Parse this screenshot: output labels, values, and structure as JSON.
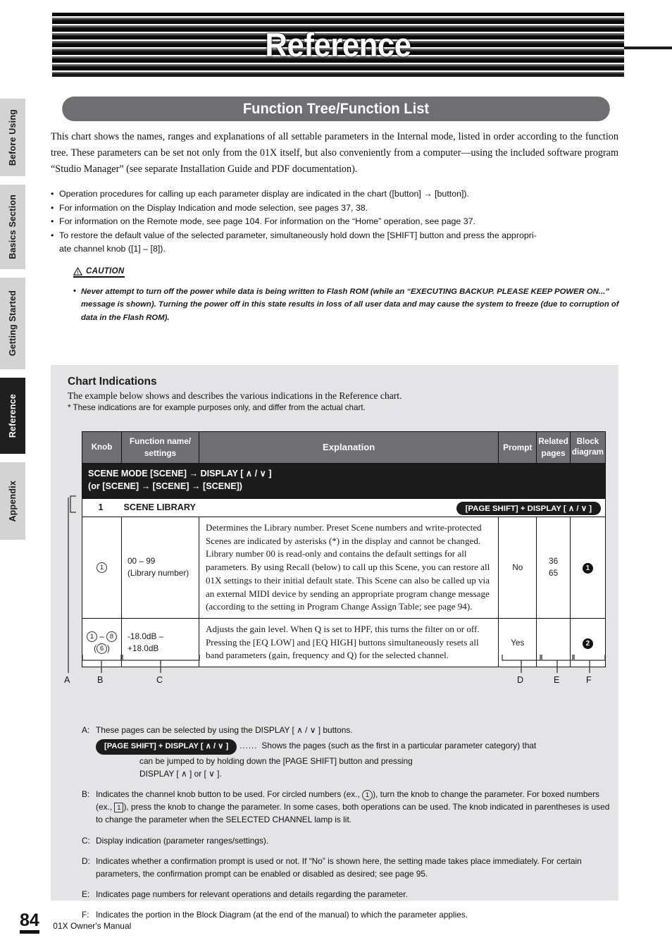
{
  "banner": {
    "title": "Reference"
  },
  "section": {
    "title": "Function Tree/Function List"
  },
  "sidebar": {
    "items": [
      {
        "label": "Before Using",
        "active": false
      },
      {
        "label": "Basics Section",
        "active": false
      },
      {
        "label": "Getting Started",
        "active": false
      },
      {
        "label": "Reference",
        "active": true
      },
      {
        "label": "Appendix",
        "active": false
      }
    ]
  },
  "intro": {
    "paragraph": "This chart shows the names, ranges and explanations of all settable parameters in the Internal mode, listed in order according to the function tree.  These parameters can be set not only from the 01X itself, but also conveniently from a computer—using the included software program “Studio Manager” (see separate Installation Guide and PDF documentation)."
  },
  "bullets": [
    "Operation procedures for calling up each parameter display are indicated in the chart ([button] → [button]).",
    "For information on the Display Indication and mode selection, see pages 37, 38.",
    "For information on the Remote mode, see page 104. For information on the “Home” operation, see page 37.",
    "To restore the default value of the selected parameter, simultaneously hold down the [SHIFT] button and press the appropri-"
  ],
  "bullet_last_cont": "ate channel knob ([1] – [8]).",
  "caution": {
    "label": "CAUTION",
    "body": "Never attempt to turn off the power while data is being written to Flash ROM (while an “EXECUTING BACKUP.  PLEASE KEEP POWER ON...” message is shown).  Turning the power off in this state results in loss of all user data and may cause the system to freeze (due to corruption of data in the Flash ROM)."
  },
  "chart_indications": {
    "title": "Chart Indications",
    "subtitle": "The example below shows and describes the various indications in the Reference chart.",
    "note": "* These indications are for example purposes only, and differ from the actual chart."
  },
  "table": {
    "headers": {
      "knob": "Knob",
      "function": "Function name/\nsettings",
      "explanation": "Explanation",
      "prompt": "Prompt",
      "related": "Related\npages",
      "block": "Block\ndiagram"
    },
    "header_function_line1": "Function name/",
    "header_function_line2": "settings",
    "header_related_line1": "Related",
    "header_related_line2": "pages",
    "header_block_line1": "Block",
    "header_block_line2": "diagram",
    "mode_row_line1": "SCENE MODE     [SCENE] → DISPLAY [ ∧ / ∨ ]",
    "mode_row_line2": "(or [SCENE] → [SCENE] → [SCENE])",
    "section_number": "1",
    "section_name": "SCENE LIBRARY",
    "section_badge": "[PAGE SHIFT] + DISPLAY [ ∧ / ∨ ]",
    "rows": [
      {
        "knob": "①",
        "function_line1": "00 – 99",
        "function_line2": "(Library number)",
        "explanation": "Determines the Library number.  Preset Scene numbers and write-protected Scenes are indicated by asterisks (*) in the display and cannot be changed. Library number 00 is read-only and contains the default settings for all parameters.  By using Recall (below) to call up this Scene, you can restore all 01X settings to their initial default state.  This Scene can also be called up via an external MIDI device by sending an appropriate program change message (according to the setting in Program Change Assign Table; see page 94).",
        "prompt": "No",
        "related_line1": "36",
        "related_line2": "65",
        "block": "❶"
      },
      {
        "knob_line1": "① – ⑧",
        "knob_line2": "(⑥)",
        "function_line1": "-18.0dB – +18.0dB",
        "function_line2": "",
        "explanation": "Adjusts the gain level.  When Q is set to HPF, this turns the filter on or off. Pressing the [EQ LOW] and [EQ HIGH] buttons simultaneously resets all band parameters (gain, frequency and Q) for the selected channel.",
        "prompt": "Yes",
        "related_line1": "",
        "related_line2": "",
        "block": "❷"
      }
    ]
  },
  "callouts": {
    "a": "A",
    "b": "B",
    "c": "C",
    "d": "D",
    "e": "E",
    "f": "F"
  },
  "legend": {
    "a_key": "A:",
    "a_line1": "These pages can be selected by using the DISPLAY [ ∧ / ∨ ] buttons.",
    "a_pill": "[PAGE SHIFT] + DISPLAY [ ∧ / ∨ ]",
    "a_dots": "......",
    "a_line2": "Shows the pages (such as the first in a particular parameter category) that",
    "a_line3": "can be jumped to by holding down the [PAGE SHIFT] button and pressing",
    "a_line4": "DISPLAY [ ∧ ] or [ ∨ ].",
    "b_key": "B:",
    "b_text_p1": "Indicates the channel knob button to be used.  For circled numbers (ex., ",
    "b_circ": "1",
    "b_text_p2": "), turn the knob to change the parameter. For boxed numbers (ex., ",
    "b_box": "1",
    "b_text_p3": "), press the knob to change the parameter.  In some cases, both operations can be used. The knob indicated in parentheses is used to change the parameter when the SELECTED CHANNEL lamp is lit.",
    "c_key": "C:",
    "c_text": "Display indication (parameter ranges/settings).",
    "d_key": "D:",
    "d_text": "Indicates whether a confirmation prompt is used or not.  If “No” is shown here, the setting made takes place immediately.  For certain parameters, the confirmation prompt can be enabled or disabled as desired; see page 95.",
    "e_key": "E:",
    "e_text": "Indicates page numbers for relevant operations and details regarding the parameter.",
    "f_key": "F:",
    "f_text": "Indicates the portion in the Block Diagram (at the end of the manual) to which the parameter applies."
  },
  "footer": {
    "page": "84",
    "text": "01X  Owner's Manual"
  },
  "colors": {
    "panel_gray": "#e4e4e6",
    "header_gray": "#6e6e73",
    "dark": "#1c1c1c",
    "tab_gray": "#d3d3d3"
  }
}
